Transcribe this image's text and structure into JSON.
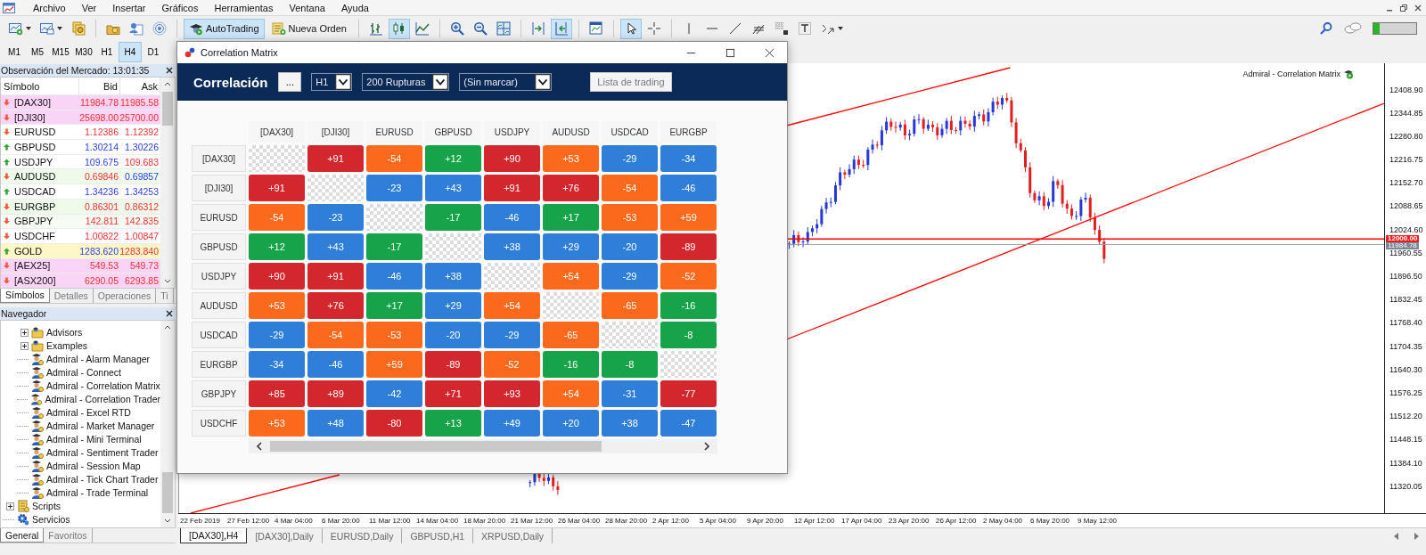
{
  "menu_bar": {
    "items": [
      "Archivo",
      "Ver",
      "Insertar",
      "Gráficos",
      "Herramientas",
      "Ventana",
      "Ayuda"
    ]
  },
  "toolbar": {
    "groups": [
      [
        {
          "kind": "new-chart",
          "selected": false
        },
        {
          "kind": "profiles",
          "selected": false
        },
        {
          "kind": "dollar",
          "selected": false
        }
      ],
      [
        {
          "kind": "folder",
          "selected": false
        },
        {
          "kind": "user",
          "selected": false
        },
        {
          "kind": "signal",
          "selected": false
        }
      ],
      [
        {
          "kind": "autotrading",
          "label": "AutoTrading",
          "selected": true
        },
        {
          "kind": "new-order",
          "label": "Nueva Orden",
          "selected": false
        }
      ],
      [
        {
          "kind": "bar-chart",
          "selected": false
        },
        {
          "kind": "candles",
          "selected": true
        },
        {
          "kind": "line-chart",
          "selected": false
        }
      ],
      [
        {
          "kind": "zoom-in",
          "selected": false
        },
        {
          "kind": "zoom-out",
          "selected": false
        },
        {
          "kind": "tile",
          "selected": false
        }
      ],
      [
        {
          "kind": "shift",
          "selected": false
        },
        {
          "kind": "autoscroll",
          "selected": true
        }
      ],
      [
        {
          "kind": "template",
          "selected": false
        }
      ],
      [
        {
          "kind": "cursor",
          "selected": true
        },
        {
          "kind": "crosshair",
          "selected": false
        }
      ],
      [
        {
          "kind": "vline",
          "selected": false
        },
        {
          "kind": "hline",
          "selected": false
        },
        {
          "kind": "trendline",
          "selected": false
        },
        {
          "kind": "fibo",
          "selected": false
        },
        {
          "kind": "grid-f",
          "selected": false
        },
        {
          "kind": "text",
          "selected": false
        },
        {
          "kind": "arrows",
          "selected": false
        }
      ]
    ]
  },
  "timeframes": [
    {
      "label": "M1",
      "selected": false
    },
    {
      "label": "M5",
      "selected": false
    },
    {
      "label": "M15",
      "selected": false
    },
    {
      "label": "M30",
      "selected": false
    },
    {
      "label": "H1",
      "selected": false
    },
    {
      "label": "H4",
      "selected": true
    },
    {
      "label": "D1",
      "selected": false
    }
  ],
  "market_watch": {
    "title": "Observación del Mercado: 13:01:35",
    "columns": [
      "Símbolo",
      "Bid",
      "Ask"
    ],
    "rows": [
      {
        "symbol": "[DAX30]",
        "bid": "11984.78",
        "ask": "11985.58",
        "up": false,
        "bid_up": false,
        "ask_up": false,
        "color": "#fad4f6"
      },
      {
        "symbol": "[DJI30]",
        "bid": "25698.00",
        "ask": "25700.00",
        "up": false,
        "bid_up": false,
        "ask_up": false,
        "color": "#fad4f6"
      },
      {
        "symbol": "EURUSD",
        "bid": "1.12386",
        "ask": "1.12392",
        "up": false,
        "bid_up": false,
        "ask_up": false,
        "color": "#ffffff"
      },
      {
        "symbol": "GBPUSD",
        "bid": "1.30214",
        "ask": "1.30226",
        "up": true,
        "bid_up": true,
        "ask_up": true,
        "color": "#ffffff"
      },
      {
        "symbol": "USDJPY",
        "bid": "109.675",
        "ask": "109.683",
        "up": true,
        "bid_up": true,
        "ask_up": false,
        "color": "#ffffff"
      },
      {
        "symbol": "AUDUSD",
        "bid": "0.69846",
        "ask": "0.69857",
        "up": false,
        "bid_up": false,
        "ask_up": true,
        "color": "#eefaea"
      },
      {
        "symbol": "USDCAD",
        "bid": "1.34236",
        "ask": "1.34253",
        "up": true,
        "bid_up": true,
        "ask_up": true,
        "color": "#ffffff"
      },
      {
        "symbol": "EURGBP",
        "bid": "0.86301",
        "ask": "0.86312",
        "up": false,
        "bid_up": false,
        "ask_up": false,
        "color": "#eefaea"
      },
      {
        "symbol": "GBPJPY",
        "bid": "142.811",
        "ask": "142.835",
        "up": false,
        "bid_up": false,
        "ask_up": false,
        "color": "#f6fcf3"
      },
      {
        "symbol": "USDCHF",
        "bid": "1.00822",
        "ask": "1.00847",
        "up": false,
        "bid_up": false,
        "ask_up": false,
        "color": "#ffffff"
      },
      {
        "symbol": "GOLD",
        "bid": "1283.620",
        "ask": "1283.840",
        "up": true,
        "bid_up": true,
        "ask_up": false,
        "color": "#fdf7c8"
      },
      {
        "symbol": "[AEX25]",
        "bid": "549.53",
        "ask": "549.73",
        "up": false,
        "bid_up": false,
        "ask_up": false,
        "color": "#fad4f6"
      },
      {
        "symbol": "[ASX200]",
        "bid": "6290.05",
        "ask": "6293.85",
        "up": false,
        "bid_up": false,
        "ask_up": false,
        "color": "#fad4f6"
      }
    ],
    "tabs": [
      {
        "label": "Símbolos",
        "selected": true
      },
      {
        "label": "Detalles",
        "selected": false
      },
      {
        "label": "Operaciones",
        "selected": false
      },
      {
        "label": "Ti",
        "selected": false
      }
    ]
  },
  "navigator": {
    "title": "Navegador",
    "items": [
      {
        "label": "Advisors",
        "kind": "folder"
      },
      {
        "label": "Examples",
        "kind": "folder"
      },
      {
        "label": "Admiral - Alarm Manager",
        "kind": "expert"
      },
      {
        "label": "Admiral - Connect",
        "kind": "expert"
      },
      {
        "label": "Admiral - Correlation Matrix",
        "kind": "expert"
      },
      {
        "label": "Admiral - Correlation Trader",
        "kind": "expert"
      },
      {
        "label": "Admiral - Excel RTD",
        "kind": "expert"
      },
      {
        "label": "Admiral - Market Manager",
        "kind": "expert"
      },
      {
        "label": "Admiral - Mini Terminal",
        "kind": "expert"
      },
      {
        "label": "Admiral - Sentiment Trader",
        "kind": "expert"
      },
      {
        "label": "Admiral - Session Map",
        "kind": "expert"
      },
      {
        "label": "Admiral - Tick Chart Trader",
        "kind": "expert"
      },
      {
        "label": "Admiral - Trade Terminal",
        "kind": "expert"
      }
    ],
    "top_items": [
      {
        "label": "Scripts",
        "kind": "scripts"
      },
      {
        "label": "Servicios",
        "kind": "services"
      }
    ],
    "tabs": [
      {
        "label": "General",
        "selected": true
      },
      {
        "label": "Favoritos",
        "selected": false
      }
    ]
  },
  "chart": {
    "label": "Admiral - Correlation Matrix",
    "price_ticks": [
      "12408.90",
      "12344.85",
      "12280.80",
      "12216.75",
      "12152.70",
      "12088.65",
      "12024.60",
      "11960.55",
      "11896.50",
      "11832.45",
      "11768.40",
      "11704.35",
      "11640.30",
      "11576.25",
      "11512.20",
      "11448.15",
      "11384.10",
      "11320.05"
    ],
    "price_tags": [
      {
        "text": "12000.00",
        "kind": "level"
      },
      {
        "text": "11984.78",
        "kind": "bid"
      }
    ],
    "time_labels": [
      "22 Feb 2019",
      "27 Feb 12:00",
      "4 Mar 04:00",
      "6 Mar 20:00",
      "11 Mar 12:00",
      "14 Mar 04:00",
      "18 Mar 20:00",
      "21 Mar 12:00",
      "26 Mar 04:00",
      "28 Mar 20:00",
      "2 Apr 12:00",
      "5 Apr 04:00",
      "9 Apr 20:00",
      "12 Apr 12:00",
      "17 Apr 04:00",
      "23 Apr 20:00",
      "26 Apr 12:00",
      "2 May 04:00",
      "6 May 20:00",
      "9 May 12:00"
    ],
    "tabs": [
      {
        "label": "[DAX30],H4",
        "selected": true
      },
      {
        "label": "[DAX30],Daily",
        "selected": false
      },
      {
        "label": "EURUSD,Daily",
        "selected": false
      },
      {
        "label": "GBPUSD,H1",
        "selected": false
      },
      {
        "label": "XRPUSD,Daily",
        "selected": false
      }
    ]
  },
  "correlation_window": {
    "title": "Correlation Matrix",
    "heading": "Correlación",
    "more_button": "...",
    "selects": [
      {
        "value": "H1"
      },
      {
        "value": "200 Rupturas"
      },
      {
        "value": "(Sin marcar)"
      }
    ],
    "list_button": "Lista de trading",
    "columns": [
      "[DAX30]",
      "[DJI30]",
      "EURUSD",
      "GBPUSD",
      "USDJPY",
      "AUDUSD",
      "USDCAD",
      "EURGBP"
    ],
    "rows": [
      {
        "label": "[DAX30]",
        "cells": [
          {
            "kind": "blank"
          },
          {
            "kind": "value",
            "value": "+91",
            "color": "#d3272e"
          },
          {
            "kind": "value",
            "value": "-54",
            "color": "#fb6a1c"
          },
          {
            "kind": "value",
            "value": "+12",
            "color": "#17a349"
          },
          {
            "kind": "value",
            "value": "+90",
            "color": "#d3272e"
          },
          {
            "kind": "value",
            "value": "+53",
            "color": "#fb6a1c"
          },
          {
            "kind": "value",
            "value": "-29",
            "color": "#2f7ed8"
          },
          {
            "kind": "value",
            "value": "-34",
            "color": "#2f7ed8"
          }
        ]
      },
      {
        "label": "[DJI30]",
        "cells": [
          {
            "kind": "value",
            "value": "+91",
            "color": "#d3272e"
          },
          {
            "kind": "blank"
          },
          {
            "kind": "value",
            "value": "-23",
            "color": "#2f7ed8"
          },
          {
            "kind": "value",
            "value": "+43",
            "color": "#2f7ed8"
          },
          {
            "kind": "value",
            "value": "+91",
            "color": "#d3272e"
          },
          {
            "kind": "value",
            "value": "+76",
            "color": "#d3272e"
          },
          {
            "kind": "value",
            "value": "-54",
            "color": "#fb6a1c"
          },
          {
            "kind": "value",
            "value": "-46",
            "color": "#2f7ed8"
          }
        ]
      },
      {
        "label": "EURUSD",
        "cells": [
          {
            "kind": "value",
            "value": "-54",
            "color": "#fb6a1c"
          },
          {
            "kind": "value",
            "value": "-23",
            "color": "#2f7ed8"
          },
          {
            "kind": "blank"
          },
          {
            "kind": "value",
            "value": "-17",
            "color": "#17a349"
          },
          {
            "kind": "value",
            "value": "-46",
            "color": "#2f7ed8"
          },
          {
            "kind": "value",
            "value": "+17",
            "color": "#17a349"
          },
          {
            "kind": "value",
            "value": "-53",
            "color": "#fb6a1c"
          },
          {
            "kind": "value",
            "value": "+59",
            "color": "#fb6a1c"
          }
        ]
      },
      {
        "label": "GBPUSD",
        "cells": [
          {
            "kind": "value",
            "value": "+12",
            "color": "#17a349"
          },
          {
            "kind": "value",
            "value": "+43",
            "color": "#2f7ed8"
          },
          {
            "kind": "value",
            "value": "-17",
            "color": "#17a349"
          },
          {
            "kind": "blank"
          },
          {
            "kind": "value",
            "value": "+38",
            "color": "#2f7ed8"
          },
          {
            "kind": "value",
            "value": "+29",
            "color": "#2f7ed8"
          },
          {
            "kind": "value",
            "value": "-20",
            "color": "#2f7ed8"
          },
          {
            "kind": "value",
            "value": "-89",
            "color": "#d3272e"
          }
        ]
      },
      {
        "label": "USDJPY",
        "cells": [
          {
            "kind": "value",
            "value": "+90",
            "color": "#d3272e"
          },
          {
            "kind": "value",
            "value": "+91",
            "color": "#d3272e"
          },
          {
            "kind": "value",
            "value": "-46",
            "color": "#2f7ed8"
          },
          {
            "kind": "value",
            "value": "+38",
            "color": "#2f7ed8"
          },
          {
            "kind": "blank"
          },
          {
            "kind": "value",
            "value": "+54",
            "color": "#fb6a1c"
          },
          {
            "kind": "value",
            "value": "-29",
            "color": "#2f7ed8"
          },
          {
            "kind": "value",
            "value": "-52",
            "color": "#fb6a1c"
          }
        ]
      },
      {
        "label": "AUDUSD",
        "cells": [
          {
            "kind": "value",
            "value": "+53",
            "color": "#fb6a1c"
          },
          {
            "kind": "value",
            "value": "+76",
            "color": "#d3272e"
          },
          {
            "kind": "value",
            "value": "+17",
            "color": "#17a349"
          },
          {
            "kind": "value",
            "value": "+29",
            "color": "#2f7ed8"
          },
          {
            "kind": "value",
            "value": "+54",
            "color": "#fb6a1c"
          },
          {
            "kind": "blank"
          },
          {
            "kind": "value",
            "value": "-65",
            "color": "#fb6a1c"
          },
          {
            "kind": "value",
            "value": "-16",
            "color": "#17a349"
          }
        ]
      },
      {
        "label": "USDCAD",
        "cells": [
          {
            "kind": "value",
            "value": "-29",
            "color": "#2f7ed8"
          },
          {
            "kind": "value",
            "value": "-54",
            "color": "#fb6a1c"
          },
          {
            "kind": "value",
            "value": "-53",
            "color": "#fb6a1c"
          },
          {
            "kind": "value",
            "value": "-20",
            "color": "#2f7ed8"
          },
          {
            "kind": "value",
            "value": "-29",
            "color": "#2f7ed8"
          },
          {
            "kind": "value",
            "value": "-65",
            "color": "#fb6a1c"
          },
          {
            "kind": "blank"
          },
          {
            "kind": "value",
            "value": "-8",
            "color": "#17a349"
          }
        ]
      },
      {
        "label": "EURGBP",
        "cells": [
          {
            "kind": "value",
            "value": "-34",
            "color": "#2f7ed8"
          },
          {
            "kind": "value",
            "value": "-46",
            "color": "#2f7ed8"
          },
          {
            "kind": "value",
            "value": "+59",
            "color": "#fb6a1c"
          },
          {
            "kind": "value",
            "value": "-89",
            "color": "#d3272e"
          },
          {
            "kind": "value",
            "value": "-52",
            "color": "#fb6a1c"
          },
          {
            "kind": "value",
            "value": "-16",
            "color": "#17a349"
          },
          {
            "kind": "value",
            "value": "-8",
            "color": "#17a349"
          },
          {
            "kind": "blank"
          }
        ]
      },
      {
        "label": "GBPJPY",
        "cells": [
          {
            "kind": "value",
            "value": "+85",
            "color": "#d3272e"
          },
          {
            "kind": "value",
            "value": "+89",
            "color": "#d3272e"
          },
          {
            "kind": "value",
            "value": "-42",
            "color": "#2f7ed8"
          },
          {
            "kind": "value",
            "value": "+71",
            "color": "#d3272e"
          },
          {
            "kind": "value",
            "value": "+93",
            "color": "#d3272e"
          },
          {
            "kind": "value",
            "value": "+54",
            "color": "#fb6a1c"
          },
          {
            "kind": "value",
            "value": "-31",
            "color": "#2f7ed8"
          },
          {
            "kind": "value",
            "value": "-77",
            "color": "#d3272e"
          }
        ]
      },
      {
        "label": "USDCHF",
        "cells": [
          {
            "kind": "value",
            "value": "+53",
            "color": "#fb6a1c"
          },
          {
            "kind": "value",
            "value": "+48",
            "color": "#2f7ed8"
          },
          {
            "kind": "value",
            "value": "-80",
            "color": "#d3272e"
          },
          {
            "kind": "value",
            "value": "+13",
            "color": "#17a349"
          },
          {
            "kind": "value",
            "value": "+49",
            "color": "#2f7ed8"
          },
          {
            "kind": "value",
            "value": "+20",
            "color": "#2f7ed8"
          },
          {
            "kind": "value",
            "value": "+38",
            "color": "#2f7ed8"
          },
          {
            "kind": "value",
            "value": "-47",
            "color": "#2f7ed8"
          }
        ]
      }
    ]
  }
}
